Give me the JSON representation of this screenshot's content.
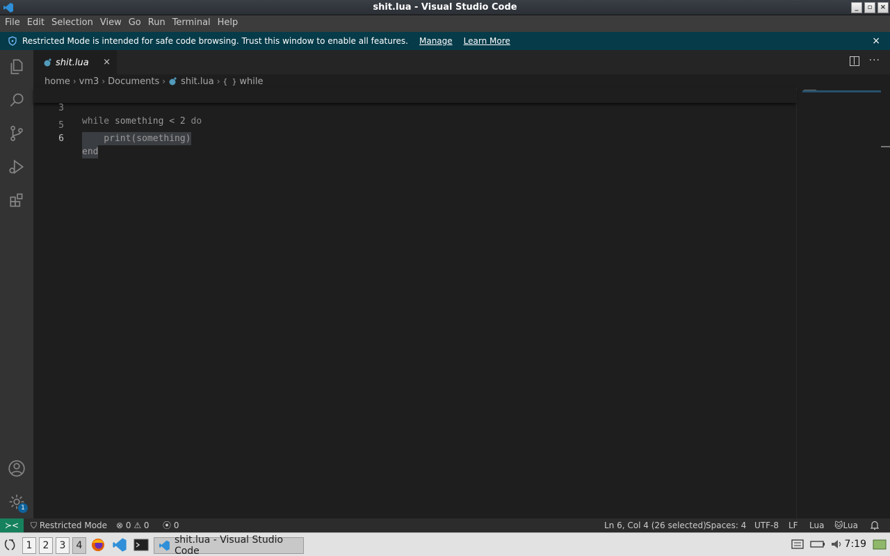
{
  "window": {
    "title": "shit.lua - Visual Studio Code",
    "buttons": [
      "_",
      "▫",
      "×"
    ]
  },
  "menu": [
    "File",
    "Edit",
    "Selection",
    "View",
    "Go",
    "Run",
    "Terminal",
    "Help"
  ],
  "banner": {
    "text": "Restricted Mode is intended for safe code browsing. Trust this window to enable all features.",
    "manage": "Manage",
    "learn_more": "Learn More",
    "close": "×"
  },
  "tab": {
    "name": "shit.lua",
    "close": "×"
  },
  "editor_actions": {
    "more": "···"
  },
  "breadcrumb": {
    "parts": [
      "home",
      "vm3",
      "Documents"
    ],
    "file": "shit.lua",
    "symbol_icon": "{ }",
    "symbol": "while",
    "separator": "›"
  },
  "code": {
    "sticky": {
      "number": "3",
      "kw1": "while",
      "rest": " something < 2 ",
      "kw2": "do"
    },
    "lines": [
      {
        "number": "5",
        "text": "    print(something)"
      },
      {
        "number": "6",
        "text": "end"
      }
    ]
  },
  "activity_badge": "1",
  "status": {
    "remote_icon": "≻<",
    "restricted": "Restricted Mode",
    "errors": "0",
    "warnings": "0",
    "ports": "0",
    "position": "Ln 6, Col 4 (26 selected)",
    "spaces": "Spaces: 4",
    "encoding": "UTF-8",
    "eol": "LF",
    "language": "Lua",
    "extension": "Lua"
  },
  "taskbar": {
    "workspaces": [
      "1",
      "2",
      "3",
      "4"
    ],
    "active_workspace": "4",
    "task_title": "shit.lua - Visual Studio Code",
    "clock": "7:19"
  },
  "colors": {
    "banner": "#063b49",
    "remote": "#16825d",
    "accent": "#0e639c"
  }
}
